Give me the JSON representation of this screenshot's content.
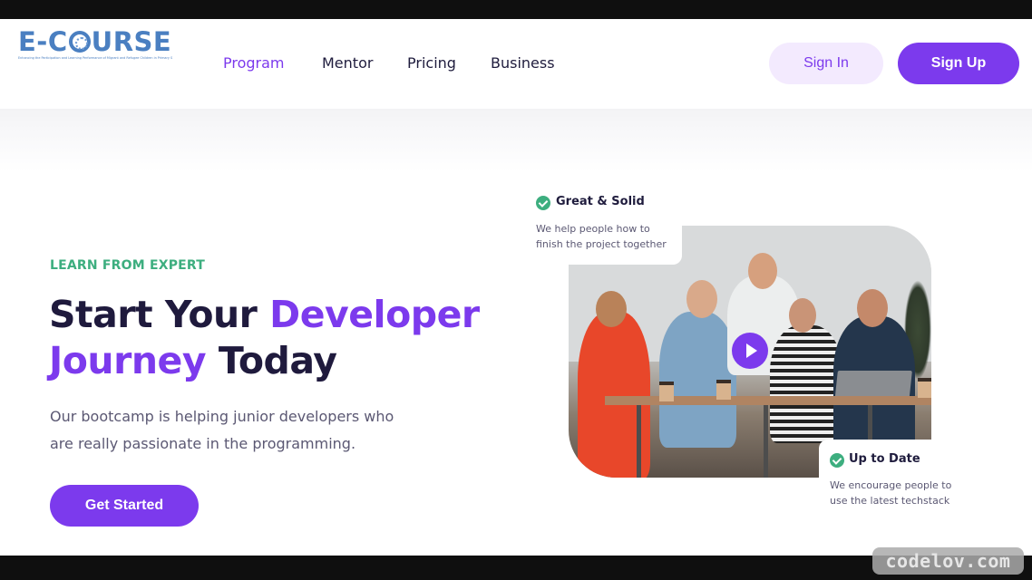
{
  "brand": {
    "logo_text_before": "E-C",
    "logo_text_after": "URSE",
    "tagline": "Enhancing the Participation and Learning Performance of Migrant and Refugee Children in Primary School Education",
    "color": "#4a7fc1"
  },
  "nav": {
    "items": [
      {
        "label": "Program",
        "active": true
      },
      {
        "label": "Mentor",
        "active": false
      },
      {
        "label": "Pricing",
        "active": false
      },
      {
        "label": "Business",
        "active": false
      }
    ]
  },
  "auth": {
    "sign_in_label": "Sign In",
    "sign_up_label": "Sign Up"
  },
  "hero": {
    "eyebrow": "LEARN FROM EXPERT",
    "headline": {
      "part1": "Start Your ",
      "accent1": "Developer",
      "accent2": "Journey",
      "part2": " Today"
    },
    "description_line1": "Our bootcamp is helping junior developers who",
    "description_line2": "are really passionate in the programming.",
    "cta_label": "Get Started"
  },
  "media": {
    "image_alt": "Team of five developers collaborating around a table with laptop and coffee cups",
    "play_icon": "play-icon"
  },
  "cards": [
    {
      "title": "Great & Solid",
      "line1": "We help people how to",
      "line2": "finish the project together",
      "icon": "check-circle-icon"
    },
    {
      "title": "Up to Date",
      "line1": "We encourage people to",
      "line2": "use the latest techstack",
      "icon": "check-circle-icon"
    }
  ],
  "watermark": "codelov.com",
  "colors": {
    "primary": "#7c3aed",
    "primary_light": "#f3eafe",
    "success": "#3dae7f",
    "heading": "#1f1a3d",
    "body_text": "#5b5873"
  }
}
